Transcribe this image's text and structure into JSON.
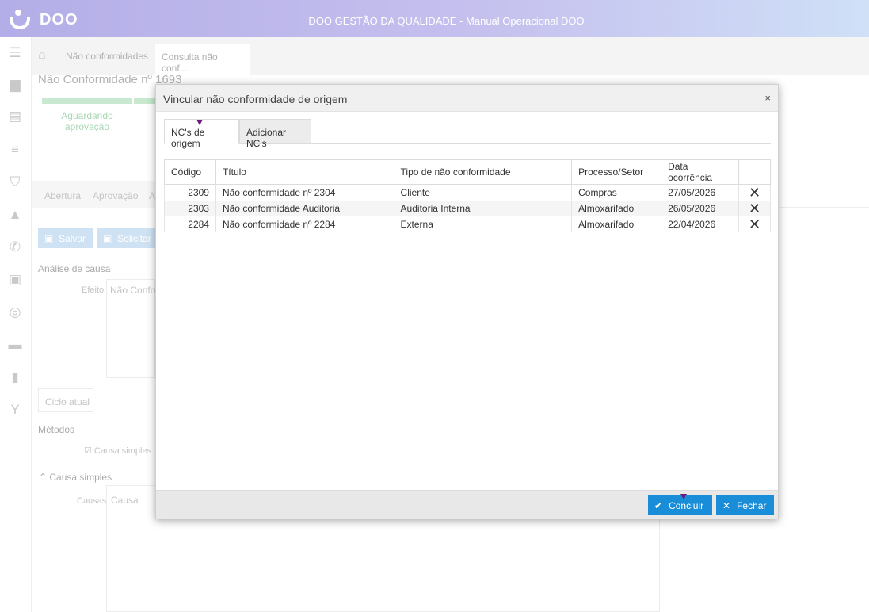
{
  "app": {
    "logo_text": "DOO",
    "title": "DOO GESTÃO DA QUALIDADE - Manual Operacional DOO"
  },
  "sidebar": {
    "icons": [
      "menu-icon",
      "folder-icon",
      "clipboard-icon",
      "list-icon",
      "shield-check-icon",
      "warning-icon",
      "phone-icon",
      "contact-card-icon",
      "target-icon",
      "truck-icon",
      "bar-chart-icon",
      "fork-icon"
    ]
  },
  "breadcrumb": {
    "items": [
      "Não conformidades"
    ],
    "active": "Consulta não conf..."
  },
  "background": {
    "page_title": "Não Conformidade nº 1693",
    "status_label": "Aguardando aprovação",
    "tabs": [
      "Abertura",
      "Aprovação",
      "A"
    ],
    "save_label": "Salvar",
    "request_label": "Solicitar",
    "analysis_label": "Análise de causa",
    "effect_label": "Efeito",
    "effect_value": "Não Confo",
    "cycle_tab": "Ciclo atual",
    "methods_label": "Métodos",
    "simple_cause_check": "Causa simples",
    "simple_cause_section": "Causa simples",
    "causes_label": "Causas",
    "causes_placeholder": "Causa"
  },
  "modal": {
    "title": "Vincular não conformidade de origem",
    "close_glyph": "×",
    "tabs": [
      {
        "label": "NC's de origem",
        "active": true
      },
      {
        "label": "Adicionar NC's",
        "active": false
      }
    ],
    "columns": [
      "Código",
      "Título",
      "Tipo de não conformidade",
      "Processo/Setor",
      "Data ocorrência"
    ],
    "rows": [
      {
        "codigo": "2309",
        "titulo": "Não conformidade nº 2304",
        "tipo": "Cliente",
        "processo": "Compras",
        "data": "27/05/2026"
      },
      {
        "codigo": "2303",
        "titulo": "Não conformidade Auditoria",
        "tipo": "Auditoria Interna",
        "processo": "Almoxarifado",
        "data": "26/05/2026"
      },
      {
        "codigo": "2284",
        "titulo": "Não conformidade nº 2284",
        "tipo": "Externa",
        "processo": "Almoxarifado",
        "data": "22/04/2026"
      }
    ],
    "conclude_label": "Concluir",
    "close_label": "Fechar"
  },
  "colors": {
    "accent": "#1a8dd8",
    "annotation_arrow": "#6b1b7b"
  }
}
